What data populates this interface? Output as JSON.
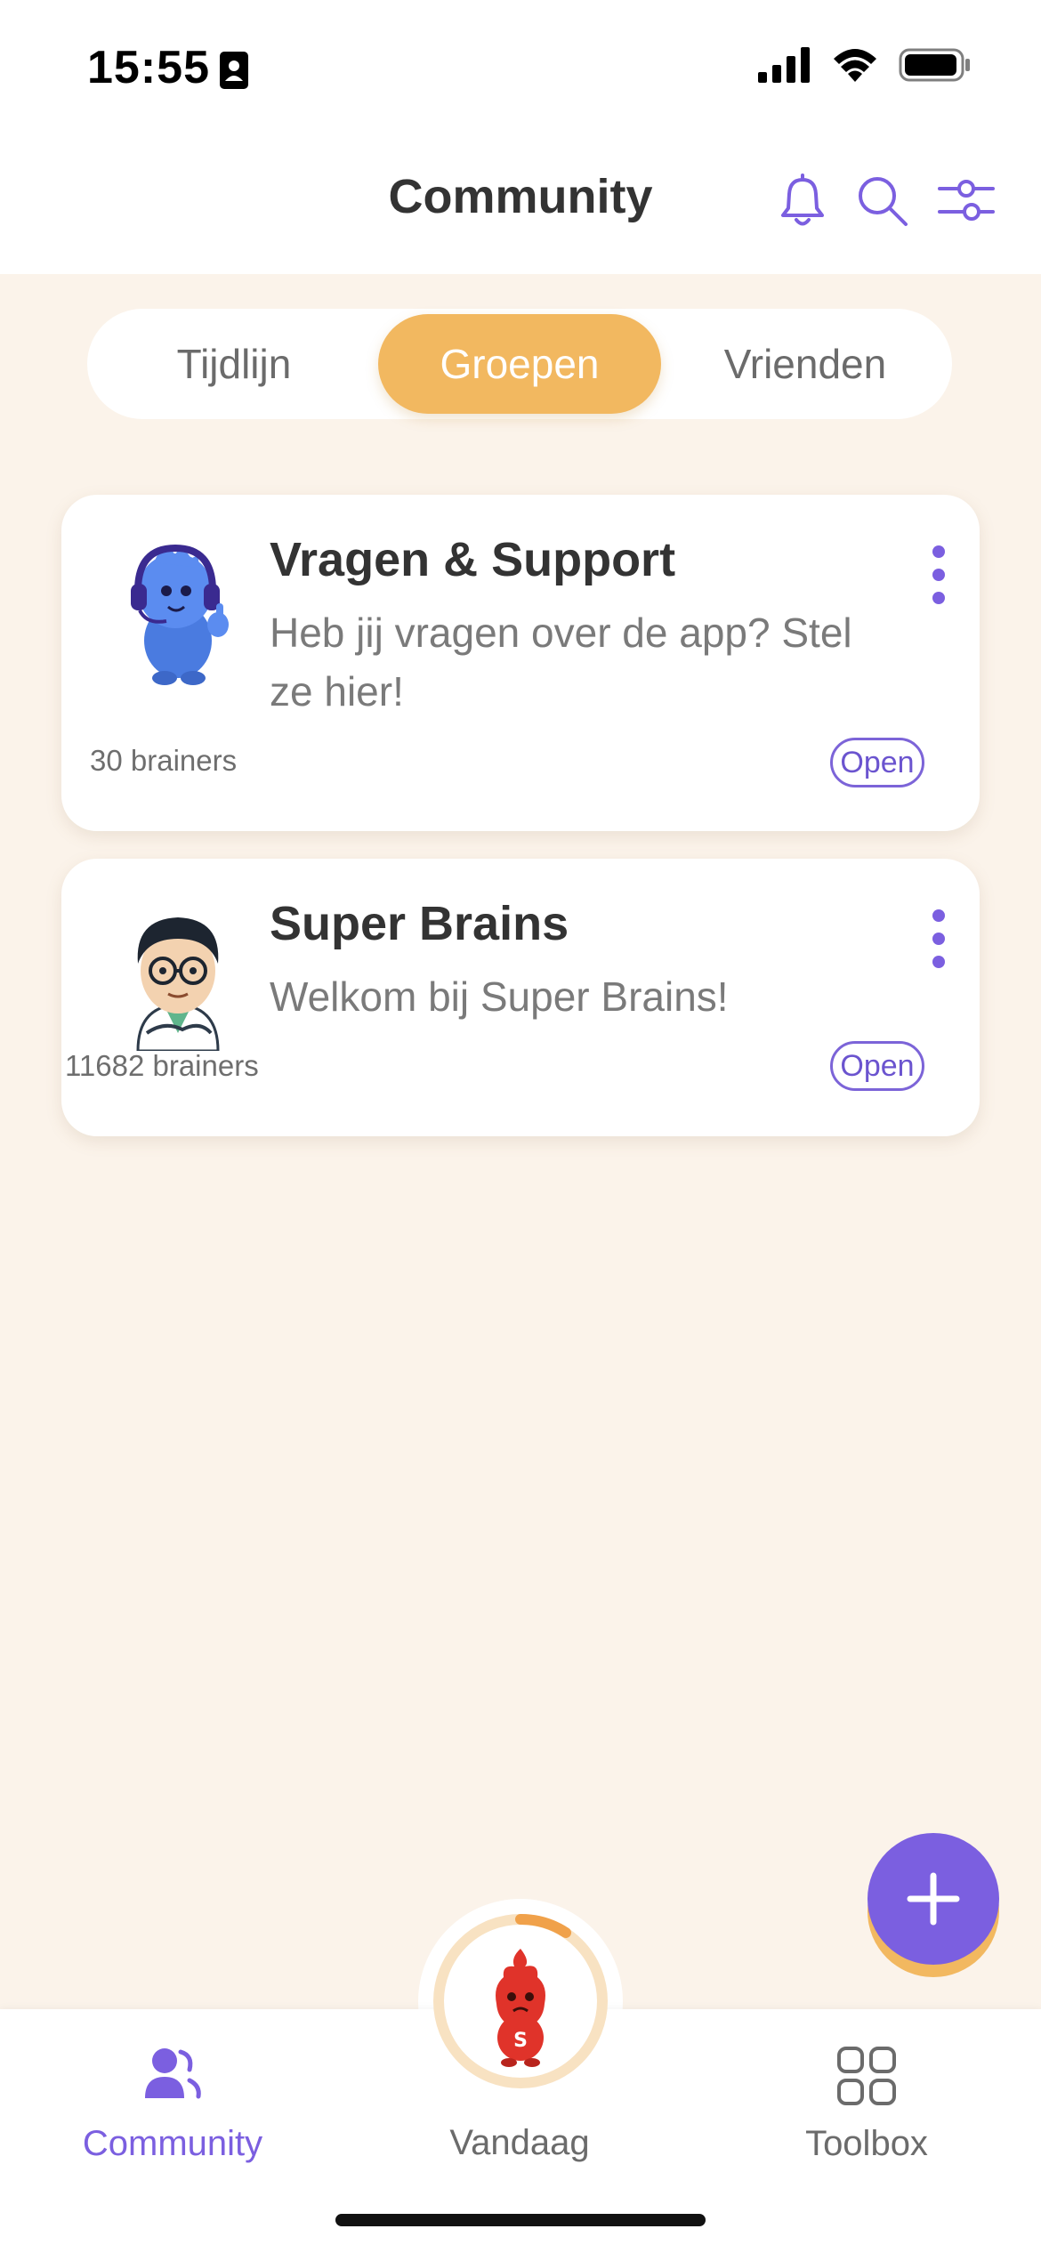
{
  "status_bar": {
    "time": "15:55"
  },
  "header": {
    "title": "Community"
  },
  "segments": [
    {
      "label": "Tijdlijn",
      "active": false
    },
    {
      "label": "Groepen",
      "active": true
    },
    {
      "label": "Vrienden",
      "active": false
    }
  ],
  "groups": [
    {
      "title": "Vragen & Support",
      "description": "Heb jij vragen over de app? Stel ze hier!",
      "members": "30 brainers",
      "action": "Open"
    },
    {
      "title": "Super Brains",
      "description": "Welkom bij Super Brains!",
      "members": "11682 brainers",
      "action": "Open"
    }
  ],
  "tabbar": {
    "community": "Community",
    "vandaag": "Vandaag",
    "toolbox": "Toolbox"
  },
  "colors": {
    "accent": "#7b5fe0",
    "segment_active": "#f2b860",
    "background": "#fbf3ea"
  },
  "icons": [
    "bell-icon",
    "search-icon",
    "filter-icon",
    "more-vertical-icon",
    "plus-icon",
    "community-icon",
    "toolbox-icon"
  ]
}
